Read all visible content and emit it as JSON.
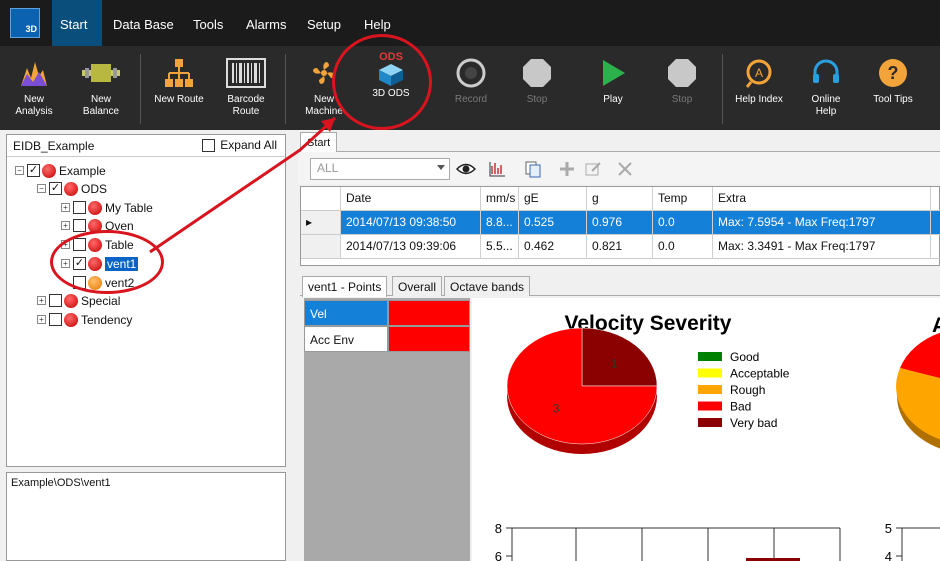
{
  "menu": {
    "items": [
      "Start",
      "Data Base",
      "Tools",
      "Alarms",
      "Setup",
      "Help"
    ],
    "active": 0,
    "logo": "3D"
  },
  "ribbon": {
    "new_analysis": "New\nAnalysis",
    "new_balance": "New\nBalance",
    "new_route": "New Route",
    "barcode_route": "Barcode\nRoute",
    "new_machine": "New\nMachine",
    "ods_badge": "ODS",
    "3d_ods": "3D ODS",
    "record": "Record",
    "stop": "Stop",
    "play": "Play",
    "stop2": "Stop",
    "help_index": "Help Index",
    "online_help": "Online\nHelp",
    "tool_tips": "Tool Tips"
  },
  "left": {
    "db_name": "EIDB_Example",
    "expand_all": "Expand All",
    "tree": {
      "example": "Example",
      "ods": "ODS",
      "my_table": "My Table",
      "oven": "Oven",
      "table": "Table",
      "vent1": "vent1",
      "vent2": "vent2",
      "special": "Special",
      "tendency": "Tendency"
    },
    "path": "Example\\ODS\\vent1"
  },
  "start_tab": "Start",
  "filter": {
    "value": "ALL"
  },
  "grid": {
    "headers": [
      "Date",
      "mm/s",
      "gE",
      "g",
      "Temp",
      "Extra"
    ],
    "rows": [
      [
        "2014/07/13 09:38:50",
        "8.8...",
        "0.525",
        "0.976",
        "0.0",
        "Max: 7.5954 - Max Freq:1797"
      ],
      [
        "2014/07/13 09:39:06",
        "5.5...",
        "0.462",
        "0.821",
        "0.0",
        "Max: 3.3491 - Max Freq:1797"
      ]
    ]
  },
  "detail_tabs": [
    "vent1 - Points",
    "Overall",
    "Octave bands"
  ],
  "points": [
    {
      "label": "Vel"
    },
    {
      "label": "Acc Env"
    }
  ],
  "colors": {
    "good": "#008000",
    "acceptable": "#ffff00",
    "rough": "#ffa500",
    "bad": "#ff0000",
    "very_bad": "#8b0000",
    "accent": "#0a4f7c",
    "annotation": "#d9141e"
  },
  "chart_data": [
    {
      "type": "pie",
      "title": "Velocity Severity",
      "legend": [
        "Good",
        "Acceptable",
        "Rough",
        "Bad",
        "Very bad"
      ],
      "legend_placement": "right",
      "slices": [
        {
          "category": "Bad",
          "label": "3",
          "value": 3
        },
        {
          "category": "Very bad",
          "label": "1",
          "value": 1
        }
      ]
    },
    {
      "type": "bar",
      "yticks": [
        "8",
        "6"
      ],
      "ylim": [
        0,
        8
      ]
    },
    {
      "type": "bar",
      "yticks": [
        "5",
        "4"
      ],
      "ylim": [
        0,
        5
      ]
    }
  ]
}
